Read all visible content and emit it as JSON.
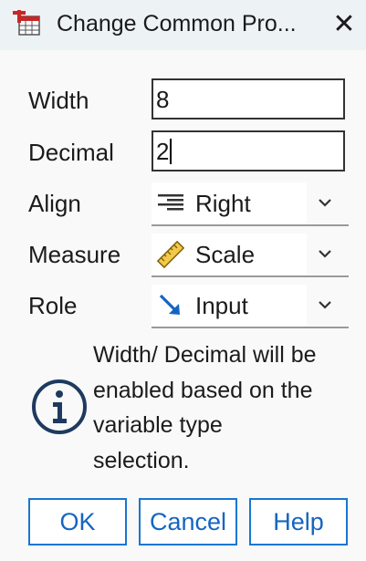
{
  "window": {
    "title": "Change Common Pro...",
    "close_glyph": "✕"
  },
  "form": {
    "width": {
      "label": "Width",
      "value": "8"
    },
    "decimal": {
      "label": "Decimal",
      "value": "2"
    },
    "align": {
      "label": "Align",
      "value": "Right",
      "icon": "align-right-icon"
    },
    "measure": {
      "label": "Measure",
      "value": "Scale",
      "icon": "ruler-scale-icon"
    },
    "role": {
      "label": "Role",
      "value": "Input",
      "icon": "input-arrow-icon"
    }
  },
  "info": {
    "icon": "info-icon",
    "lines": [
      "Width/ Decimal will be",
      "enabled based on the",
      "variable type",
      "selection."
    ]
  },
  "buttons": {
    "ok": "OK",
    "cancel": "Cancel",
    "help": "Help"
  },
  "colors": {
    "accent": "#1976d2",
    "titlebar_bg": "#edf2f5",
    "dialog_bg": "#f9f9f9",
    "info_icon": "#1e3a5f",
    "role_icon": "#1565c0",
    "measure_icon": "#d4a017",
    "app_icon_red": "#c62828"
  }
}
